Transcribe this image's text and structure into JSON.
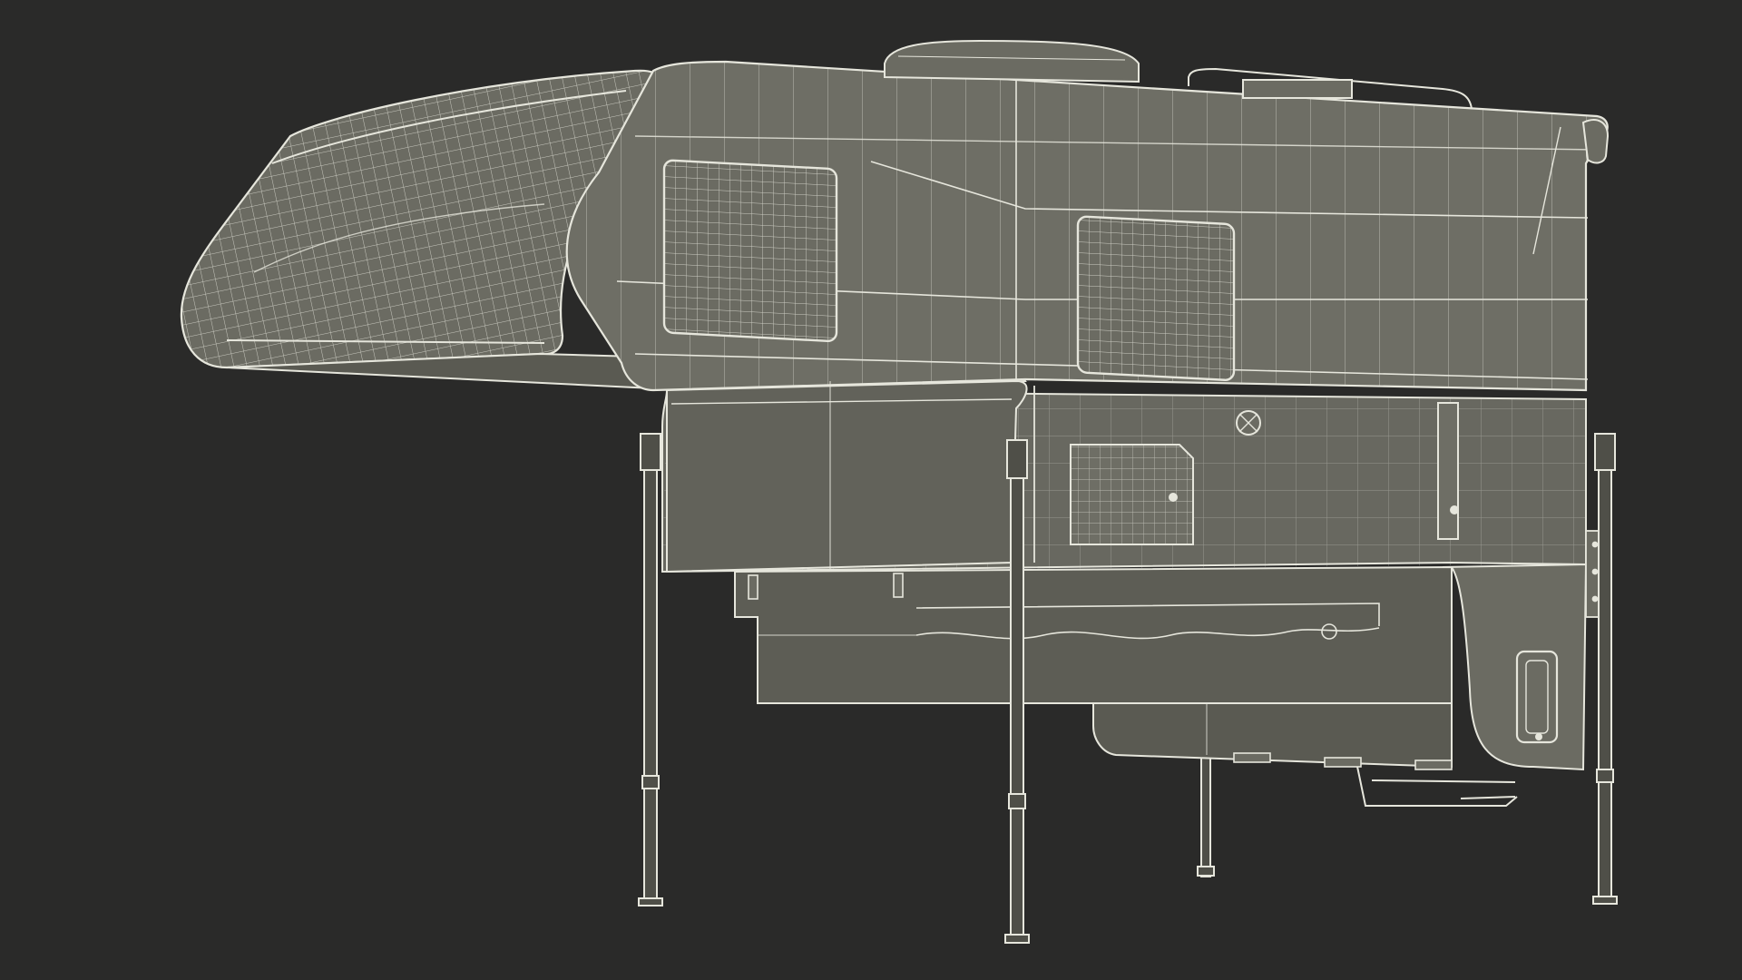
{
  "scene": {
    "subject": "truck-camper-wireframe",
    "colors": {
      "background": "#2a2a29",
      "surface": "#6b6b62",
      "surface_dark": "#5a5a52",
      "surface_light": "#76766c",
      "wire": "#e6e6dc",
      "wire_dim": "#bdbdb2",
      "leg": "#4f4f48"
    }
  }
}
